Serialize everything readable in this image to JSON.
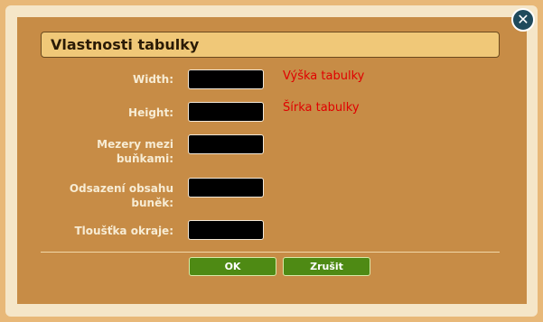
{
  "dialog": {
    "title": "Vlastnosti tabulky",
    "close_symbol": "✕"
  },
  "fields": [
    {
      "label": "Width:",
      "value": "",
      "hint": "Výška tabulky"
    },
    {
      "label": "Height:",
      "value": "",
      "hint": "Šírka tabulky"
    },
    {
      "label": "Mezery mezi buňkami:",
      "value": ""
    },
    {
      "label": "Odsazení obsahu buněk:",
      "value": ""
    },
    {
      "label": "Tloušťka okraje:",
      "value": ""
    }
  ],
  "buttons": {
    "ok_label": "OK",
    "cancel_label": "Zrušit"
  },
  "colors": {
    "dialog_bg": "#c78c46",
    "title_bg": "#f0c878",
    "hint_color": "#e00000",
    "button_green": "#4e8a14"
  }
}
